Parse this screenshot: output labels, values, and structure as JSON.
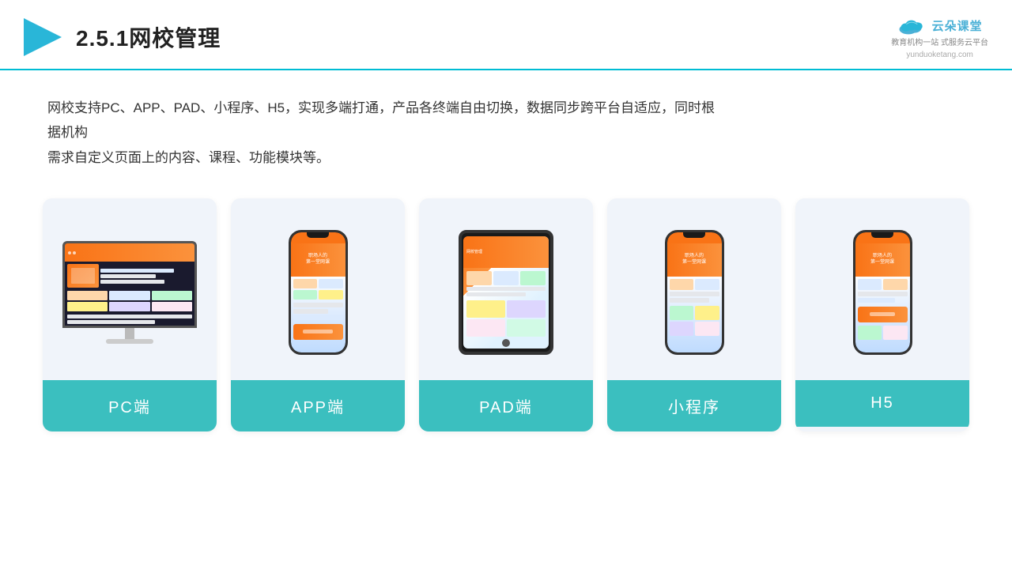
{
  "header": {
    "title": "2.5.1网校管理",
    "logo": {
      "brand": "云朵课堂",
      "url": "yunduoketang.com",
      "tagline": "教育机构一站\n式服务云平台"
    }
  },
  "description": {
    "text": "网校支持PC、APP、PAD、小程序、H5，实现多端打通，产品各终端自由切换，数据同步跨平台自适应，同时根据机构需求自定义页面上的内容、课程、功能模块等。"
  },
  "devices": [
    {
      "id": "pc",
      "label": "PC端",
      "type": "monitor"
    },
    {
      "id": "app",
      "label": "APP端",
      "type": "phone"
    },
    {
      "id": "pad",
      "label": "PAD端",
      "type": "tablet"
    },
    {
      "id": "mini",
      "label": "小程序",
      "type": "phone-notched"
    },
    {
      "id": "h5",
      "label": "H5",
      "type": "phone-notched"
    }
  ],
  "colors": {
    "accent": "#3bbfbf",
    "border": "#00bcd4"
  }
}
